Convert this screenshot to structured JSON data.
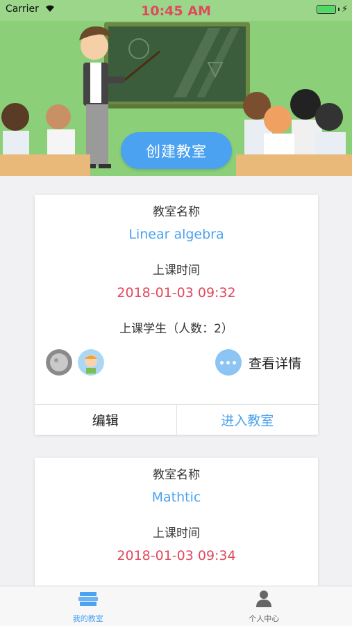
{
  "status_bar": {
    "carrier": "Carrier",
    "time": "10:45 AM"
  },
  "banner": {
    "create_button": "创建教室"
  },
  "classrooms": [
    {
      "name_label": "教室名称",
      "name": "Linear algebra",
      "time_label": "上课时间",
      "time": "2018-01-03 09:32",
      "students_label": "上课学生（人数：2）",
      "details_label": "查看详情",
      "edit_label": "编辑",
      "enter_label": "进入教室"
    },
    {
      "name_label": "教室名称",
      "name": "Mathtic",
      "time_label": "上课时间",
      "time": "2018-01-03 09:34"
    }
  ],
  "tab_bar": {
    "items": [
      {
        "label": "我的教室",
        "icon": "books-icon",
        "active": true
      },
      {
        "label": "个人中心",
        "icon": "person-icon",
        "active": false
      }
    ]
  },
  "colors": {
    "accent": "#4aa2f0",
    "time": "#e0495d",
    "banner_bg": "#8ccf79"
  }
}
